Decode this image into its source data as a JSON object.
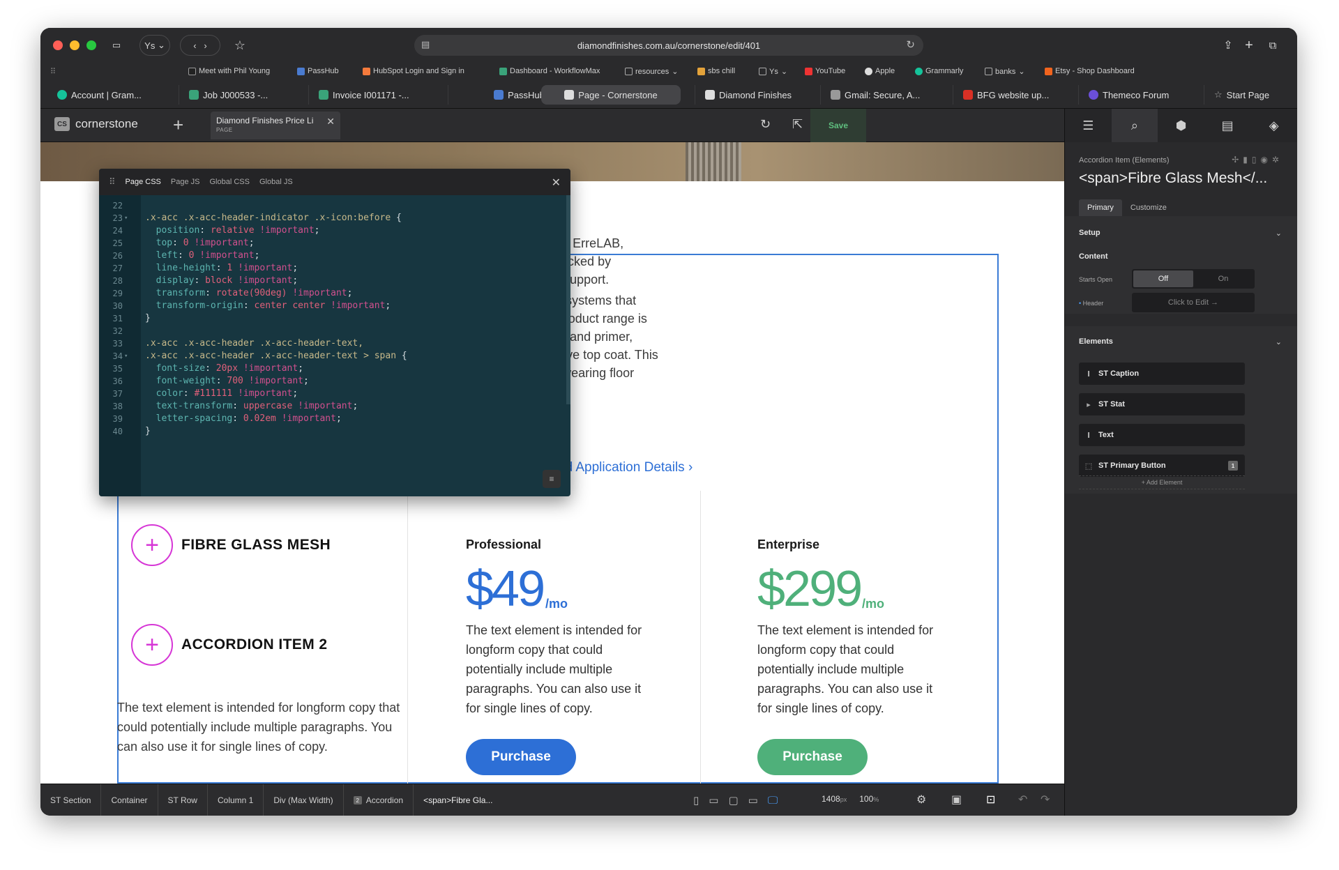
{
  "browser": {
    "url": "diamondfinishes.com.au/cornerstone/edit/401",
    "profile": "Ys",
    "bookmarks": [
      "Meet with Phil Young",
      "PassHub",
      "HubSpot Login and Sign in",
      "Dashboard - WorkflowMax",
      "resources",
      "sbs chill",
      "Ys",
      "YouTube",
      "Apple",
      "Grammarly",
      "banks",
      "Etsy - Shop Dashboard"
    ],
    "tabs": [
      "Account | Gram...",
      "Job J000533 -...",
      "Invoice I001171 -...",
      "PassHub",
      "Page - Cornerstone",
      "Diamond Finishes",
      "Gmail: Secure, A...",
      "BFG website up...",
      "Themeco Forum",
      "Start Page"
    ]
  },
  "cornerstone": {
    "logo": "cornerstone",
    "logo_box": "CS",
    "doc_tab_title": "Diamond Finishes Price Li",
    "doc_tab_type": "PAGE",
    "save_label": "Save"
  },
  "code_editor": {
    "tabs": [
      "Page CSS",
      "Page JS",
      "Global CSS",
      "Global JS"
    ],
    "lines": [
      {
        "n": "22",
        "fold": "",
        "code": ""
      },
      {
        "n": "23",
        "fold": "▾",
        "code": ".x-acc .x-acc-header-indicator .x-icon:before {"
      },
      {
        "n": "24",
        "fold": "",
        "code": "  position: relative !important;"
      },
      {
        "n": "25",
        "fold": "",
        "code": "  top: 0 !important;"
      },
      {
        "n": "26",
        "fold": "",
        "code": "  left: 0 !important;"
      },
      {
        "n": "27",
        "fold": "",
        "code": "  line-height: 1 !important;"
      },
      {
        "n": "28",
        "fold": "",
        "code": "  display: block !important;"
      },
      {
        "n": "29",
        "fold": "",
        "code": "  transform: rotate(90deg) !important;"
      },
      {
        "n": "30",
        "fold": "",
        "code": "  transform-origin: center center !important;"
      },
      {
        "n": "31",
        "fold": "",
        "code": "}"
      },
      {
        "n": "32",
        "fold": "",
        "code": ""
      },
      {
        "n": "33",
        "fold": "",
        "code": ".x-acc .x-acc-header .x-acc-header-text,"
      },
      {
        "n": "34",
        "fold": "▾",
        "code": ".x-acc .x-acc-header .x-acc-header-text > span {"
      },
      {
        "n": "35",
        "fold": "",
        "code": "  font-size: 20px !important;"
      },
      {
        "n": "36",
        "fold": "",
        "code": "  font-weight: 700 !important;"
      },
      {
        "n": "37",
        "fold": "",
        "code": "  color: #111111 !important;"
      },
      {
        "n": "38",
        "fold": "",
        "code": "  text-transform: uppercase !important;"
      },
      {
        "n": "39",
        "fold": "",
        "code": "  letter-spacing: 0.02em !important;"
      },
      {
        "n": "40",
        "fold": "",
        "code": "}"
      }
    ]
  },
  "canvas": {
    "intro_lines": [
      "representative for ErreLAB,",
      "finish systems backed by",
      "and trade-ready support."
    ],
    "intro_lines_2": [
      "ve wall and floor systems that",
      "hed finish. The product range is",
      "rface preparation and primer,",
      "ed with a protective top coat. This",
      "ations and hard-wearing floor",
      "d."
    ],
    "link_text": "ad Application Details  ›",
    "accordion": [
      {
        "label": "FIBRE GLASS MESH"
      },
      {
        "label": "ACCORDION ITEM 2"
      }
    ],
    "accordion_text": "The text element is intended for longform copy that could potentially include multiple paragraphs. You can also use it for single lines of copy.",
    "plans": [
      {
        "name": "Professional",
        "price": "$49",
        "per": "/mo",
        "color": "#2d6fd6",
        "text": "The text element is intended for longform copy that could potentially include multiple paragraphs. You can also use it for single lines of copy.",
        "button": "Purchase"
      },
      {
        "name": "Enterprise",
        "price": "$299",
        "per": "/mo",
        "color": "#4fb07a",
        "text": "The text element is intended for longform copy that could potentially include multiple paragraphs. You can also use it for single lines of copy.",
        "button": "Purchase"
      }
    ]
  },
  "right_panel": {
    "crumb": "Accordion Item (Elements)",
    "title": "<span>Fibre Glass Mesh</...",
    "subtabs": [
      "Primary",
      "Customize"
    ],
    "setup_label": "Setup",
    "content_label": "Content",
    "starts_open_label": "Starts Open",
    "toggle_off": "Off",
    "toggle_on": "On",
    "header_label": "Header",
    "click_to_edit": "Click to Edit →",
    "elements_label": "Elements",
    "elements": [
      {
        "icon": "text-cursor-icon",
        "label": "ST Caption"
      },
      {
        "icon": "expand-arrow-icon",
        "label": "ST Stat"
      },
      {
        "icon": "text-cursor-icon",
        "label": "Text"
      },
      {
        "icon": "button-cursor-icon",
        "label": "ST Primary Button",
        "badge": "1"
      }
    ],
    "add_element": "+ Add Element"
  },
  "bottom_bar": {
    "crumbs": [
      "ST Section",
      "Container",
      "ST Row",
      "Column 1",
      "Div (Max Width)",
      "Accordion",
      "<span>Fibre Gla..."
    ],
    "accordion_badge": "2",
    "width_value": "1408",
    "width_unit": "px",
    "zoom_value": "100",
    "zoom_unit": "%"
  },
  "colors": {
    "accent_blue": "#3a7bd5",
    "magenta": "#d636d6",
    "green": "#4fb07a",
    "save_green": "#5fbf7f"
  }
}
